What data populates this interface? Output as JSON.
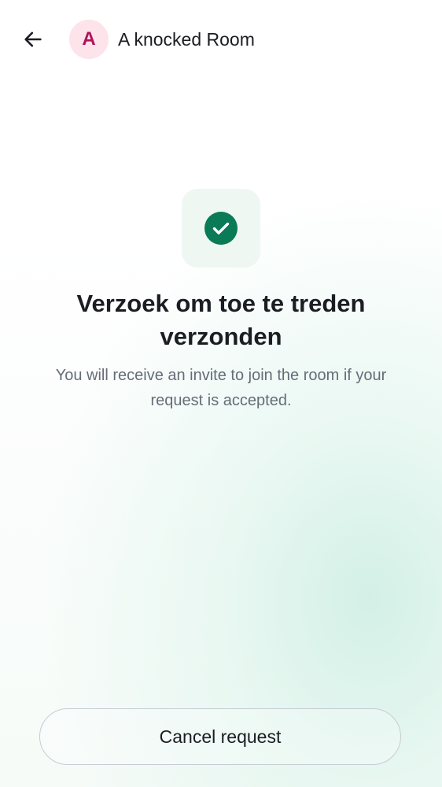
{
  "header": {
    "back_icon": "arrow-left-icon",
    "avatar_initial": "A",
    "room_name": "A knocked Room"
  },
  "status": {
    "icon": "check-circle-icon",
    "title": "Verzoek om toe te treden verzonden",
    "message": "You will receive an invite to join the room if your request is accepted."
  },
  "actions": {
    "cancel_label": "Cancel request"
  },
  "colors": {
    "avatar_background": "#fde3ea",
    "avatar_text": "#b0135a",
    "success_green": "#0a7a57",
    "success_tile": "#eff7f2",
    "text_primary": "#1b1d22",
    "text_secondary": "#656d77",
    "button_border": "#c7ccd3"
  }
}
